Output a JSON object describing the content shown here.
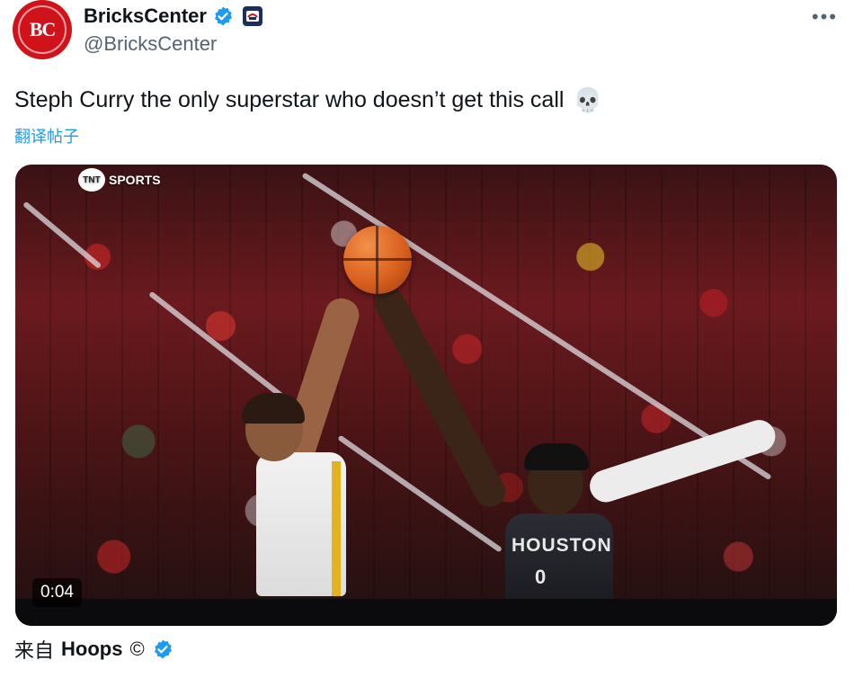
{
  "author": {
    "display_name": "BricksCenter",
    "handle": "@BricksCenter",
    "avatar_text": "BC",
    "verified_icon": "verified-checkmark-icon",
    "affiliate_icon": "team-affiliate-icon"
  },
  "menu": {
    "more_label": "•••"
  },
  "tweet": {
    "text": "Steph Curry the only superstar who doesn’t get this call",
    "emoji": "💀",
    "translate_label": "翻译帖子"
  },
  "media": {
    "network_label": "SPORTS",
    "network_badge": "TNT",
    "jersey_text": "HOUSTON",
    "jersey_number": "0",
    "duration": "0:04"
  },
  "source": {
    "prefix": "来自",
    "name": "Hoops",
    "copyright": "©"
  },
  "colors": {
    "brand_red": "#d0121b",
    "verified_blue": "#1d9bf0",
    "link_blue": "#1d9bf0",
    "text_primary": "#0f1419",
    "text_secondary": "#536471"
  }
}
